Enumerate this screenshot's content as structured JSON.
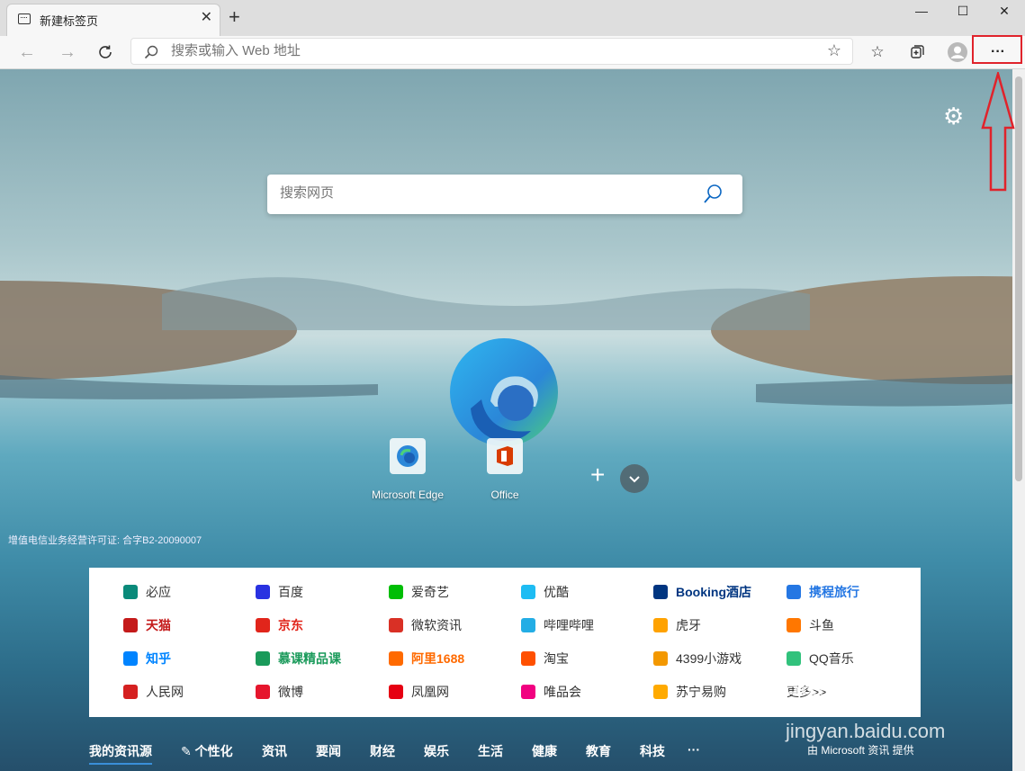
{
  "window": {
    "tab_title": "新建标签页",
    "new_tab": "+",
    "minimize": "—",
    "maximize": "☐",
    "close": "✕"
  },
  "toolbar": {
    "address_placeholder": "搜索或输入 Web 地址",
    "more_label": "···"
  },
  "page": {
    "search_placeholder": "搜索网页",
    "tiles": [
      {
        "label": "Microsoft Edge",
        "icon": "edge-icon"
      },
      {
        "label": "Office",
        "icon": "office-icon"
      }
    ],
    "license": "增值电信业务经营许可证: 合字B2-20090007"
  },
  "links": [
    [
      {
        "label": "必应",
        "color": "#0a8a7a",
        "bold": false
      },
      {
        "label": "百度",
        "color": "#2932e1",
        "bold": false
      },
      {
        "label": "爱奇艺",
        "color": "#00be06",
        "bold": false
      },
      {
        "label": "优酷",
        "color": "#1ebcf3",
        "bold": false
      },
      {
        "label": "Booking酒店",
        "color": "#003580",
        "bold": true
      },
      {
        "label": "携程旅行",
        "color": "#2577e3",
        "bold": true
      }
    ],
    [
      {
        "label": "天猫",
        "color": "#c41a1a",
        "bold": true
      },
      {
        "label": "京东",
        "color": "#e1251b",
        "bold": true
      },
      {
        "label": "微软资讯",
        "color": "#d93025",
        "bold": false
      },
      {
        "label": "哔哩哔哩",
        "color": "#23ade5",
        "bold": false
      },
      {
        "label": "虎牙",
        "color": "#ffa200",
        "bold": false
      },
      {
        "label": "斗鱼",
        "color": "#ff7700",
        "bold": false
      }
    ],
    [
      {
        "label": "知乎",
        "color": "#0084ff",
        "bold": true
      },
      {
        "label": "慕课精品课",
        "color": "#1a9a5a",
        "bold": true
      },
      {
        "label": "阿里1688",
        "color": "#ff6a00",
        "bold": true
      },
      {
        "label": "淘宝",
        "color": "#ff5000",
        "bold": false
      },
      {
        "label": "4399小游戏",
        "color": "#f39800",
        "bold": false
      },
      {
        "label": "QQ音乐",
        "color": "#31c27c",
        "bold": false
      }
    ],
    [
      {
        "label": "人民网",
        "color": "#d52020",
        "bold": false
      },
      {
        "label": "微博",
        "color": "#e6162d",
        "bold": false
      },
      {
        "label": "凤凰网",
        "color": "#e60012",
        "bold": false
      },
      {
        "label": "唯品会",
        "color": "#f10180",
        "bold": false
      },
      {
        "label": "苏宁易购",
        "color": "#ffaa00",
        "bold": false
      },
      {
        "label": "更多>>",
        "color": "",
        "bold": false
      }
    ]
  ],
  "nav": {
    "items": [
      "我的资讯源",
      "个性化",
      "资讯",
      "要闻",
      "财经",
      "娱乐",
      "生活",
      "健康",
      "教育",
      "科技",
      "···"
    ],
    "provider": "由 Microsoft 资讯 提供"
  },
  "watermark": {
    "text": "Baidu经验",
    "url": "jingyan.baidu.com"
  },
  "annotation_color": "#e0232b"
}
